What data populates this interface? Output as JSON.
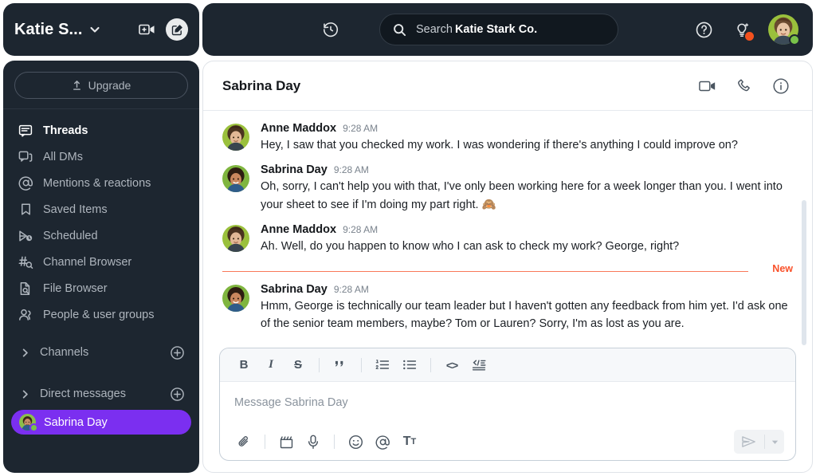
{
  "workspace": {
    "name": "Katie S...",
    "caret_icon": "chevron-down-icon",
    "new_call_icon": "new-video-call-icon",
    "compose_icon": "compose-icon"
  },
  "sidebar": {
    "upgrade_label": "Upgrade",
    "upgrade_icon": "upload-arrow-icon",
    "items": [
      {
        "label": "Threads",
        "icon": "threads-icon",
        "active": true
      },
      {
        "label": "All DMs",
        "icon": "all-dms-icon",
        "active": false
      },
      {
        "label": "Mentions & reactions",
        "icon": "at-mention-icon",
        "active": false
      },
      {
        "label": "Saved Items",
        "icon": "bookmark-icon",
        "active": false
      },
      {
        "label": "Scheduled",
        "icon": "scheduled-send-icon",
        "active": false
      },
      {
        "label": "Channel Browser",
        "icon": "channel-search-icon",
        "active": false
      },
      {
        "label": "File Browser",
        "icon": "file-search-icon",
        "active": false
      },
      {
        "label": "People & user groups",
        "icon": "people-icon",
        "active": false
      }
    ],
    "sections": [
      {
        "label": "Channels",
        "chevron_icon": "chevron-right-icon",
        "add_icon": "plus-circle-icon"
      },
      {
        "label": "Direct messages",
        "chevron_icon": "chevron-right-icon",
        "add_icon": "plus-circle-icon"
      }
    ],
    "dms": [
      {
        "label": "Sabrina Day",
        "selected": true,
        "presence": "online"
      }
    ],
    "selected_color": "#7b2ff0"
  },
  "topbar": {
    "history_icon": "history-clock-icon",
    "search": {
      "icon": "search-icon",
      "prefix": "Search",
      "workspace": "Katie Stark Co."
    },
    "help_icon": "help-circle-icon",
    "ideas_icon": "lightbulb-icon",
    "ideas_badge": true,
    "badge_color": "#f4511e",
    "avatar_icon": "user-avatar",
    "presence": "online",
    "presence_color": "#79c24a"
  },
  "conversation": {
    "title": "Sabrina Day",
    "actions": [
      {
        "icon": "video-camera-icon",
        "name": "start-huddle-video"
      },
      {
        "icon": "phone-icon",
        "name": "start-call"
      },
      {
        "icon": "info-circle-icon",
        "name": "conversation-details"
      }
    ],
    "new_divider_label": "New",
    "new_divider_color": "#f9512a",
    "messages": [
      {
        "author": "Anne Maddox",
        "time": "9:28 AM",
        "text": "Hey, I saw that you checked my work. I was wondering if there's anything I could improve on?",
        "avatar": "anne-maddox-avatar"
      },
      {
        "author": "Sabrina Day",
        "time": "9:28 AM",
        "text": "Oh, sorry, I can't help you with that, I've only been working here for a week longer than you. I went into your sheet to see if I'm doing my part right. 🙈",
        "avatar": "sabrina-day-avatar"
      },
      {
        "author": "Anne Maddox",
        "time": "9:28 AM",
        "text": "Ah. Well, do you happen to know who I can ask to check my work? George, right?",
        "avatar": "anne-maddox-avatar"
      },
      {
        "author": "Sabrina Day",
        "time": "9:28 AM",
        "text": "Hmm, George is technically our team leader but I haven't gotten any feedback from him yet. I'd ask one of the senior team members, maybe? Tom or Lauren? Sorry, I'm as lost as you are.",
        "avatar": "sabrina-day-avatar"
      }
    ]
  },
  "composer": {
    "placeholder": "Message Sabrina Day",
    "format_buttons": [
      {
        "name": "bold-button",
        "glyph": "B"
      },
      {
        "name": "italic-button",
        "glyph": "I"
      },
      {
        "name": "strikethrough-button",
        "glyph": "S"
      },
      {
        "name": "blockquote-button",
        "glyph": "””"
      },
      {
        "name": "ordered-list-button",
        "glyph": "ordered-list-icon"
      },
      {
        "name": "bulleted-list-button",
        "glyph": "bulleted-list-icon"
      },
      {
        "name": "code-button",
        "glyph": "<>"
      },
      {
        "name": "code-block-button",
        "glyph": "code-block-icon"
      }
    ],
    "action_buttons": [
      {
        "name": "attach-file-button",
        "icon": "paperclip-icon"
      },
      {
        "name": "record-clip-button",
        "icon": "video-clip-icon"
      },
      {
        "name": "record-audio-button",
        "icon": "microphone-icon"
      },
      {
        "name": "emoji-button",
        "icon": "emoji-smiley-icon"
      },
      {
        "name": "mention-button",
        "icon": "at-mention-icon"
      },
      {
        "name": "formatting-button",
        "icon": "text-formatting-icon"
      }
    ],
    "send_icon": "send-paper-plane-icon",
    "send_caret_icon": "chevron-down-icon"
  }
}
